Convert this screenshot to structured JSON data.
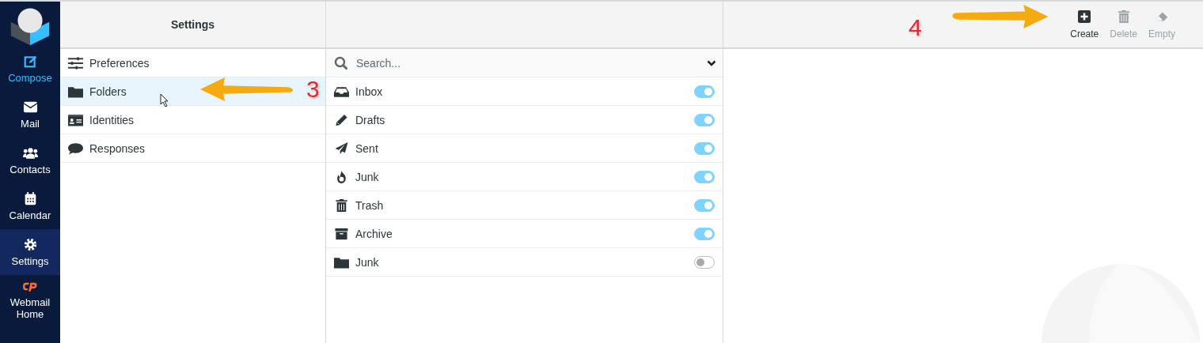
{
  "nav": [
    {
      "kind": "compose",
      "label": "Compose",
      "selected": false
    },
    {
      "kind": "mail",
      "label": "Mail",
      "selected": false
    },
    {
      "kind": "contacts",
      "label": "Contacts",
      "selected": false
    },
    {
      "kind": "calendar",
      "label": "Calendar",
      "selected": false
    },
    {
      "kind": "settings",
      "label": "Settings",
      "selected": true
    },
    {
      "kind": "cpanel",
      "label": "Webmail Home",
      "selected": false
    }
  ],
  "settings": {
    "title": "Settings",
    "items": [
      {
        "kind": "preferences",
        "label": "Preferences",
        "selected": false
      },
      {
        "kind": "folders",
        "label": "Folders",
        "selected": true
      },
      {
        "kind": "identities",
        "label": "Identities",
        "selected": false
      },
      {
        "kind": "responses",
        "label": "Responses",
        "selected": false
      }
    ]
  },
  "folders": {
    "search": {
      "placeholder": "Search..."
    },
    "items": [
      {
        "kind": "inbox",
        "label": "Inbox",
        "on": true
      },
      {
        "kind": "drafts",
        "label": "Drafts",
        "on": true
      },
      {
        "kind": "sent",
        "label": "Sent",
        "on": true
      },
      {
        "kind": "junk",
        "label": "Junk",
        "on": true
      },
      {
        "kind": "trash",
        "label": "Trash",
        "on": true
      },
      {
        "kind": "archive",
        "label": "Archive",
        "on": true
      },
      {
        "kind": "folder",
        "label": "Junk",
        "on": false
      }
    ]
  },
  "toolbar": [
    {
      "kind": "create",
      "label": "Create",
      "disabled": false
    },
    {
      "kind": "delete",
      "label": "Delete",
      "disabled": true
    },
    {
      "kind": "empty",
      "label": "Empty",
      "disabled": true
    }
  ],
  "annotations": [
    {
      "number": "3"
    },
    {
      "number": "4"
    }
  ]
}
